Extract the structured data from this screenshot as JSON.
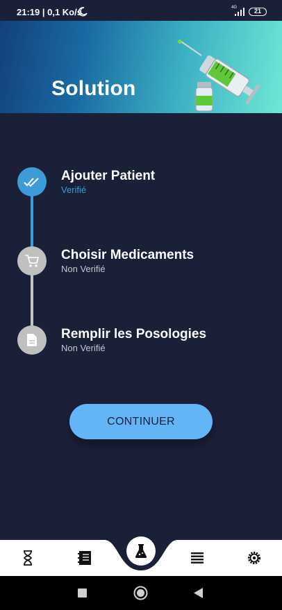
{
  "status_bar": {
    "time": "21:19 | 0,1 Ko/s",
    "network": "4G",
    "battery": "21"
  },
  "header": {
    "title": "Solution",
    "illustration": "syringe-and-vial"
  },
  "steps": [
    {
      "title": "Ajouter Patient",
      "status": "Verifié",
      "done": true,
      "icon": "double-check-icon"
    },
    {
      "title": "Choisir Medicaments",
      "status": "Non Verifié",
      "done": false,
      "icon": "cart-icon"
    },
    {
      "title": "Remplir les Posologies",
      "status": "Non Verifié",
      "done": false,
      "icon": "document-icon"
    }
  ],
  "continue_button": {
    "label": "CONTINUER"
  },
  "bottom_nav": {
    "items": [
      "hourglass-icon",
      "notebook-icon",
      "flask-icon",
      "list-icon",
      "gear-icon"
    ],
    "active": "flask-icon"
  },
  "colors": {
    "background": "#1b2039",
    "accent": "#3d9cd8",
    "button": "#64b5f6",
    "inactive": "#c0c0c0"
  }
}
